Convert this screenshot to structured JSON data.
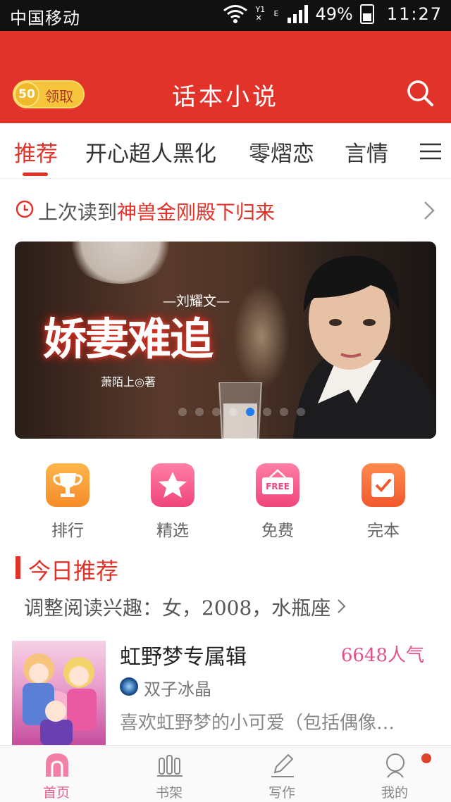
{
  "status_bar": {
    "carrier": "中国移动",
    "network_top": "Y1",
    "network_e": "E",
    "battery": "49%",
    "time": "11:27"
  },
  "header": {
    "coin_count": "50",
    "claim_label": "领取",
    "title": "话本小说",
    "accent_color": "#e2332a"
  },
  "tabs": [
    {
      "label": "推荐",
      "active": true
    },
    {
      "label": "开心超人黑化",
      "active": false
    },
    {
      "label": "零熠恋",
      "active": false
    },
    {
      "label": "言情",
      "active": false
    }
  ],
  "last_read": {
    "prefix": "上次读到",
    "book": "神兽金刚殿下归来"
  },
  "banner": {
    "author_line": "—刘耀文—",
    "title": "娇妻难追",
    "writer": "萧陌上◎著",
    "active_dot": 4,
    "dot_count": 8
  },
  "quick_links": [
    {
      "label": "排行",
      "icon": "trophy-icon"
    },
    {
      "label": "精选",
      "icon": "star-icon"
    },
    {
      "label": "免费",
      "icon": "free-tag-icon",
      "badge_text": "FREE"
    },
    {
      "label": "完本",
      "icon": "check-book-icon"
    }
  ],
  "today": {
    "title": "今日推荐",
    "interest": "调整阅读兴趣：女，2008，水瓶座"
  },
  "book": {
    "title": "虹野梦专属辑",
    "popularity": "6648人气",
    "author": "双子冰晶",
    "description": "喜欢虹野梦的小可爱（包括偶像…"
  },
  "bottom_nav": [
    {
      "label": "首页",
      "icon": "home-icon",
      "active": true
    },
    {
      "label": "书架",
      "icon": "bookshelf-icon",
      "active": false
    },
    {
      "label": "写作",
      "icon": "pen-icon",
      "active": false
    },
    {
      "label": "我的",
      "icon": "profile-icon",
      "active": false
    }
  ]
}
